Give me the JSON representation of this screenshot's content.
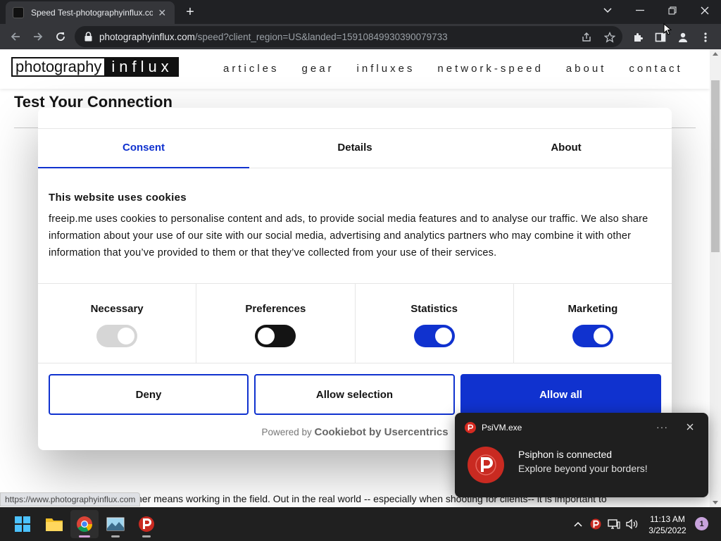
{
  "browser": {
    "tab_title": "Speed Test-photographyinflux.com",
    "tab_close": "✕",
    "new_tab": "+",
    "url_host": "photographyinflux.com",
    "url_path": "/speed?client_region=US&landed=15910849930390079733"
  },
  "site": {
    "logo_part1": "photography",
    "logo_part2": "influx",
    "nav": [
      "articles",
      "gear",
      "influxes",
      "network-speed",
      "about",
      "contact"
    ],
    "page_title": "Test Your Connection",
    "body_text": "Part of being a photographer means working in the field. Out in the real world -- especially when shooting for clients-- it is important to"
  },
  "cookie_dialog": {
    "tabs": [
      "Consent",
      "Details",
      "About"
    ],
    "active_tab": "Consent",
    "heading": "This website uses cookies",
    "text": "freeip.me uses cookies to personalise content and ads, to provide social media features and to analyse our traffic. We also share information about your use of our site with our social media, advertising and analytics partners who may combine it with other information that you’ve provided to them or that they’ve collected from your use of their services.",
    "categories": [
      {
        "label": "Necessary",
        "enabled": true,
        "disabled": true
      },
      {
        "label": "Preferences",
        "enabled": false,
        "disabled": false
      },
      {
        "label": "Statistics",
        "enabled": true,
        "disabled": false
      },
      {
        "label": "Marketing",
        "enabled": true,
        "disabled": false
      }
    ],
    "buttons": {
      "deny": "Deny",
      "allow_selection": "Allow selection",
      "allow_all": "Allow all"
    },
    "powered_by_prefix": "Powered by",
    "powered_by_brand": "Cookiebot by Usercentrics"
  },
  "notification": {
    "app_name": "PsiVM.exe",
    "more": "···",
    "title": "Psiphon is connected",
    "body": "Explore beyond your borders!"
  },
  "status_bar_url": "https://www.photographyinflux.com",
  "taskbar": {
    "time": "11:13 AM",
    "date": "3/25/2022",
    "notification_count": "1"
  },
  "colors": {
    "accent_blue": "#1032cf",
    "toggle_off_dark": "#141414",
    "toggle_disabled": "#d6d6d6",
    "psiphon_red": "#c92a21"
  },
  "icons": {
    "browser": [
      "back-arrow-icon",
      "forward-arrow-icon",
      "reload-icon",
      "lock-icon",
      "share-icon",
      "star-icon",
      "extensions-icon",
      "sidepanel-icon",
      "profile-icon",
      "menu-dots-icon"
    ],
    "taskbar": [
      "windows-start-icon",
      "file-explorer-icon",
      "chrome-icon",
      "image-viewer-icon",
      "psiphon-icon"
    ],
    "tray": [
      "chevron-up-icon",
      "psiphon-tray-icon",
      "network-icon",
      "volume-icon"
    ]
  }
}
